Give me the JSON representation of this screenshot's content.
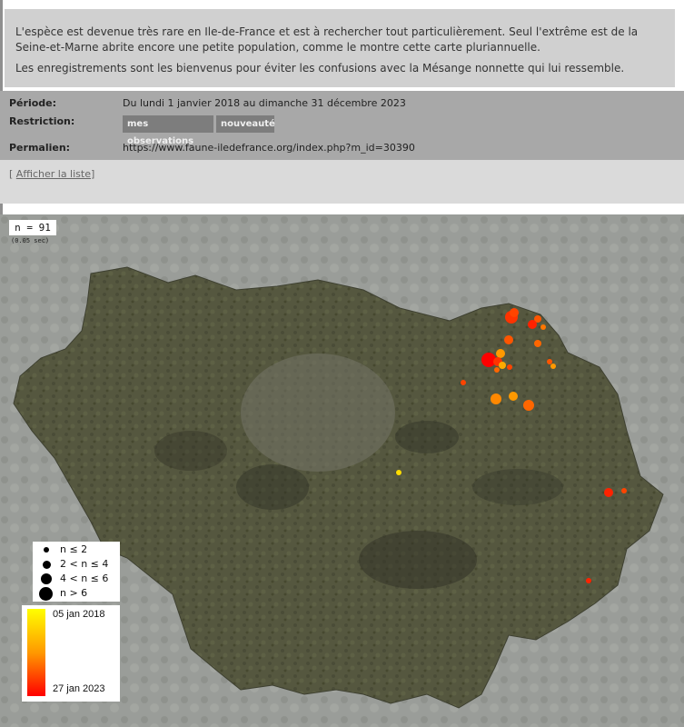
{
  "description": {
    "paragraph1": "L'espèce est devenue très rare en Ile-de-France et est à rechercher tout particulièrement. Seul l'extrême est de la Seine-et-Marne abrite encore une petite population, comme le montre cette carte pluriannuelle.",
    "paragraph2": "Les enregistrements sont les bienvenus pour éviter les confusions avec la Mésange nonnette qui lui ressemble."
  },
  "meta": {
    "period_label": "Période:",
    "period_value": "Du lundi 1 janvier 2018 au dimanche 31 décembre 2023",
    "restriction_label": "Restriction:",
    "restriction_tags": [
      "mes observations",
      "nouveauté"
    ],
    "permalink_label": "Permalien:",
    "permalink_value": "https://www.faune-iledefrance.org/index.php?m_id=30390"
  },
  "list_toggle": {
    "bracket_open": "[ ",
    "label": "Afficher la liste",
    "bracket_close": "]"
  },
  "map": {
    "count": "n = 91",
    "timing": "(0.05 sec)",
    "size_legend": [
      {
        "label": "n ≤ 2"
      },
      {
        "label": "2 < n ≤ 4"
      },
      {
        "label": "4 < n ≤ 6"
      },
      {
        "label": "n > 6"
      }
    ],
    "color_legend": {
      "start_label": "05 jan 2018",
      "end_label": "27 jan 2023",
      "start_color": "#ffff00",
      "mid_color": "#ff9900",
      "end_color": "#ff0000"
    },
    "region_color": "#4f503f",
    "background_color": "#9a9d99"
  }
}
